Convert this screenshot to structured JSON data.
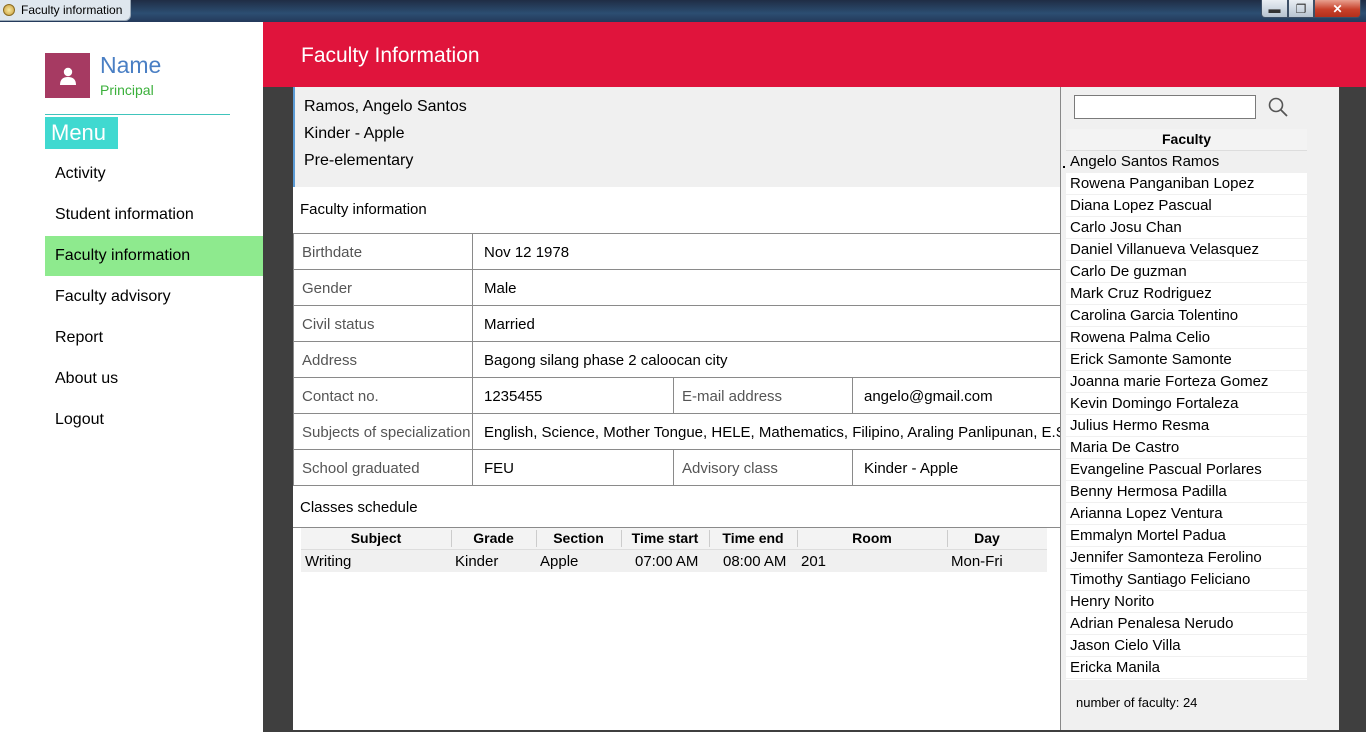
{
  "window": {
    "title": "Faculty information"
  },
  "user": {
    "name": "Name",
    "role": "Principal"
  },
  "menu": {
    "title": "Menu",
    "items": [
      {
        "label": "Activity"
      },
      {
        "label": "Student information"
      },
      {
        "label": "Faculty information"
      },
      {
        "label": "Faculty advisory"
      },
      {
        "label": "Report"
      },
      {
        "label": "About us"
      },
      {
        "label": "Logout"
      }
    ],
    "active_index": 2
  },
  "header": {
    "title": "Faculty Information"
  },
  "summary": {
    "name": "Ramos, Angelo Santos",
    "class": "Kinder - Apple",
    "level": "Pre-elementary"
  },
  "faculty_info": {
    "section_title": "Faculty information",
    "birthdate_label": "Birthdate",
    "birthdate": "Nov 12 1978",
    "gender_label": "Gender",
    "gender": "Male",
    "civil_label": "Civil status",
    "civil": "Married",
    "address_label": "Address",
    "address": "Bagong silang phase 2 caloocan city",
    "contact_label": "Contact no.",
    "contact": "1235455",
    "email_label": "E-mail address",
    "email": "angelo@gmail.com",
    "subjects_label": "Subjects of specialization",
    "subjects": "English, Science, Mother Tongue, HELE, Mathematics, Filipino, Araling Panlipunan, E.S.P.",
    "school_label": "School graduated",
    "school": "FEU",
    "advisory_label": "Advisory class",
    "advisory": "Kinder - Apple"
  },
  "schedule": {
    "section_title": "Classes schedule",
    "columns": [
      "Subject",
      "Grade",
      "Section",
      "Time start",
      "Time end",
      "Room",
      "Day"
    ],
    "rows": [
      {
        "subject": "Writing",
        "grade": "Kinder",
        "section": "Apple",
        "start": "07:00 AM",
        "end": "08:00 AM",
        "room": "201",
        "day": "Mon-Fri"
      }
    ]
  },
  "faculty_list": {
    "search_value": "",
    "header": "Faculty",
    "items": [
      "Angelo Santos Ramos",
      "Rowena Panganiban Lopez",
      "Diana Lopez Pascual",
      "Carlo Josu Chan",
      "Daniel Villanueva Velasquez",
      "Carlo  De guzman",
      "Mark Cruz Rodriguez",
      "Carolina Garcia Tolentino",
      "Rowena Palma Celio",
      "Erick Samonte Samonte",
      "Joanna marie Forteza Gomez",
      "Kevin Domingo Fortaleza",
      "Julius Hermo Resma",
      "Maria  De Castro",
      "Evangeline Pascual Porlares",
      "Benny Hermosa Padilla",
      "Arianna Lopez Ventura",
      "Emmalyn Mortel Padua",
      "Jennifer Samonteza Ferolino",
      "Timothy Santiago Feliciano",
      "Henry  Norito",
      "Adrian Penalesa Nerudo",
      "Jason Cielo Villa",
      "Ericka  Manila"
    ],
    "selected_index": 0,
    "count_text": "number of faculty: 24"
  },
  "colors": {
    "header": "#e0143c",
    "menu_title": "#40d9d0",
    "active_nav": "#8eea8e",
    "avatar": "#a63a62"
  },
  "icons": [
    "user-icon",
    "search-icon",
    "app-icon",
    "minimize-icon",
    "maximize-icon",
    "close-icon"
  ]
}
